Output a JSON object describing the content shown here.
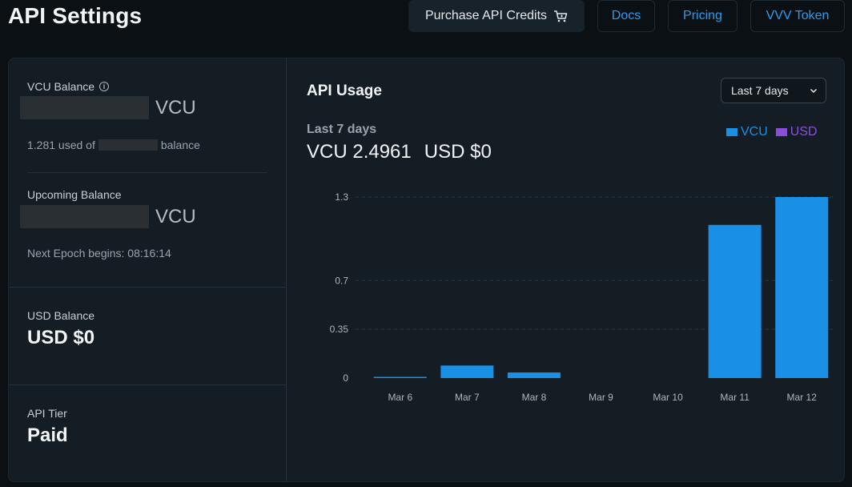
{
  "header": {
    "title": "API Settings",
    "purchase_label": "Purchase API Credits",
    "docs_label": "Docs",
    "pricing_label": "Pricing",
    "token_label": "VVV Token"
  },
  "sidebar": {
    "vcu_balance_label": "VCU Balance",
    "vcu_unit": "VCU",
    "used_prefix": "1.281 used of",
    "used_suffix": "balance",
    "upcoming_label": "Upcoming Balance",
    "upcoming_unit": "VCU",
    "next_epoch": "Next Epoch begins: 08:16:14",
    "usd_balance_label": "USD Balance",
    "usd_balance_value": "USD $0",
    "api_tier_label": "API Tier",
    "api_tier_value": "Paid"
  },
  "usage": {
    "title": "API Usage",
    "range_selected": "Last 7 days",
    "period_label": "Last 7 days",
    "vcu_total": "VCU 2.4961",
    "usd_total": "USD $0"
  },
  "colors": {
    "vcu": "#1a8fe6",
    "usd": "#8a4fd8"
  },
  "chart_data": {
    "type": "bar",
    "categories": [
      "Mar 6",
      "Mar 7",
      "Mar 8",
      "Mar 9",
      "Mar 10",
      "Mar 11",
      "Mar 12"
    ],
    "series": [
      {
        "name": "VCU",
        "values": [
          0.004,
          0.09,
          0.04,
          0,
          0,
          1.1,
          1.3
        ]
      },
      {
        "name": "USD",
        "values": [
          0,
          0,
          0,
          0,
          0,
          0,
          0
        ]
      }
    ],
    "y_ticks": [
      0,
      0.35,
      0.7,
      1.3
    ],
    "ylim": [
      0,
      1.3
    ],
    "grid": true,
    "legend": "top-right"
  }
}
